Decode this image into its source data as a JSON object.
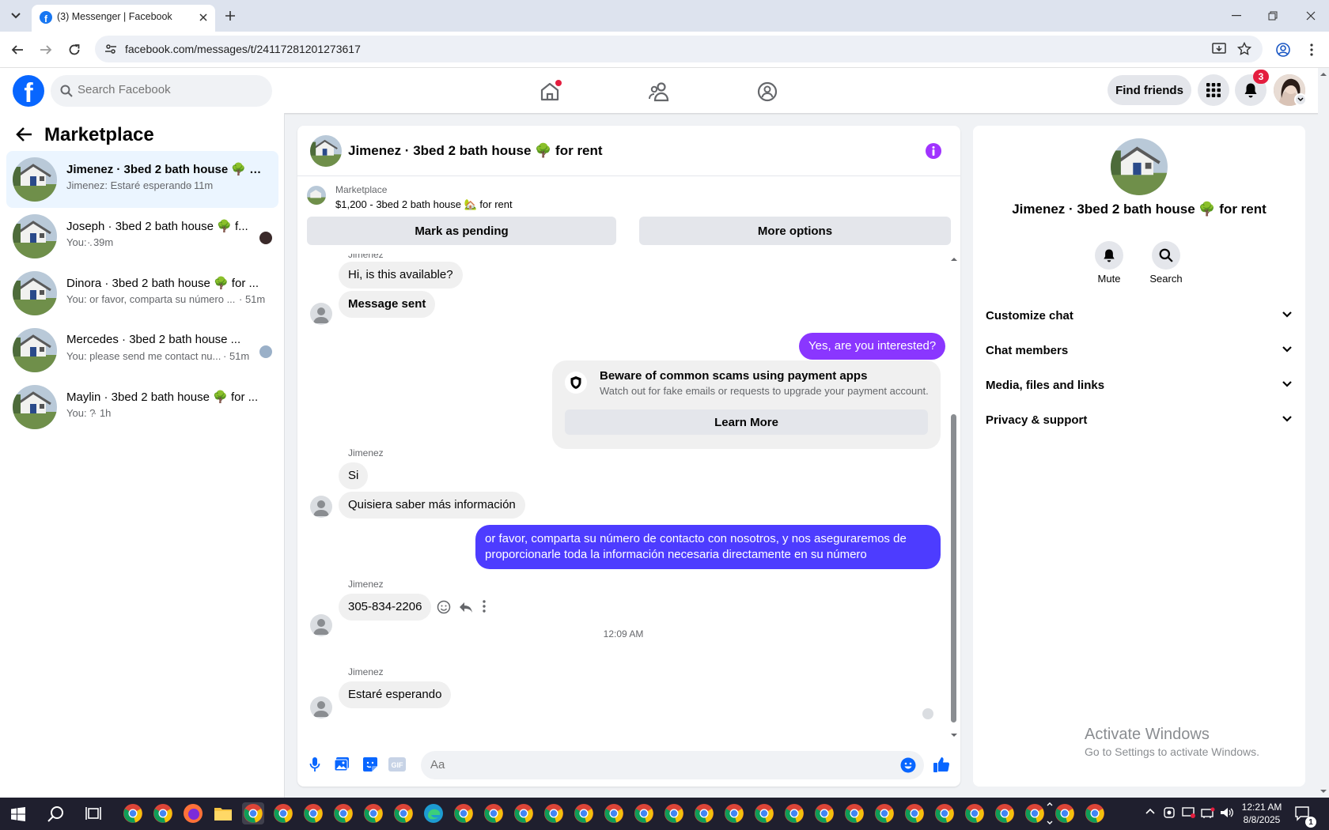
{
  "browser": {
    "tab_title": "(3) Messenger | Facebook",
    "url": "facebook.com/messages/t/24117281201273617"
  },
  "fb": {
    "search_placeholder": "Search Facebook",
    "find_friends": "Find friends",
    "notification_count": "3"
  },
  "sidebar": {
    "title": "Marketplace",
    "conversations": [
      {
        "name": "Jimenez · 3bed 2 bath house 🌳 fo...",
        "preview": "Jimenez: Estaré esperando",
        "time": "· 11m",
        "active": true
      },
      {
        "name": "Joseph · 3bed 2 bath house 🌳 f...",
        "preview": "You: .",
        "time": "· 39m",
        "active": false
      },
      {
        "name": "Dinora · 3bed 2 bath house 🌳 for ...",
        "preview": "You: or favor, comparta su número ...",
        "time": "· 51m",
        "active": false
      },
      {
        "name": "Mercedes · 3bed 2 bath house ...",
        "preview": "You: please send me contact nu...",
        "time": "· 51m",
        "active": false
      },
      {
        "name": "Maylin · 3bed 2 bath house 🌳 for ...",
        "preview": "You: ?",
        "time": "· 1h",
        "active": false
      }
    ]
  },
  "chat": {
    "title": "Jimenez · 3bed 2 bath house 🌳 for rent",
    "marketplace_label": "Marketplace",
    "listing": "$1,200 - 3bed 2 bath house 🏡 for rent",
    "mark_pending": "Mark as pending",
    "more_options": "More options",
    "sender_top": "Jimenez",
    "msg1": "Hi, is this available?",
    "msg2": "Message sent",
    "msg3": "Yes, are you interested?",
    "scam_title": "Beware of common scams using payment apps",
    "scam_text": "Watch out for fake emails or requests to upgrade your payment account.",
    "learn_more": "Learn More",
    "sender_a": "Jimenez",
    "msg4": "Si",
    "msg5": "Quisiera saber más información",
    "msg6_line1": "or favor, comparta su número de contacto con nosotros, y nos aseguraremos de",
    "msg6_line2": "proporcionarle toda la información necesaria directamente en su número",
    "sender_b": "Jimenez",
    "msg7": "305-834-2206",
    "timestamp": "12:09 AM",
    "sender_c": "Jimenez",
    "msg8": "Estaré esperando",
    "composer_placeholder": "Aa"
  },
  "rpanel": {
    "title": "Jimenez · 3bed 2 bath house 🌳 for rent",
    "mute": "Mute",
    "search": "Search",
    "sections": [
      "Customize chat",
      "Chat members",
      "Media, files and links",
      "Privacy & support"
    ]
  },
  "watermark": {
    "line1": "Activate Windows",
    "line2": "Go to Settings to activate Windows."
  },
  "taskbar": {
    "time": "12:21 AM",
    "date": "8/8/2025",
    "notif_count": "1"
  },
  "colors": {
    "fb_blue": "#0866ff",
    "my_bubble": "#8a36ff",
    "my_bubble_2": "#4d3cff",
    "info_purple": "#a033ff",
    "badge_red": "#e41e3f"
  }
}
